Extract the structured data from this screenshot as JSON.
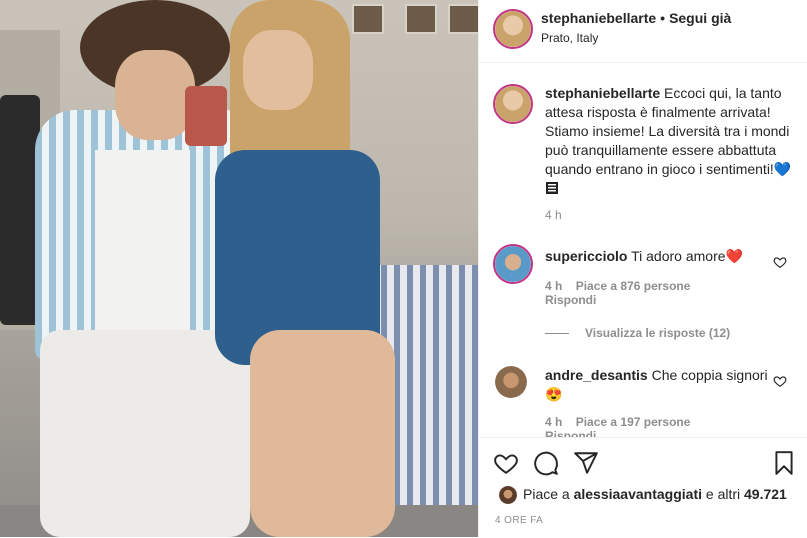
{
  "post": {
    "author": "stephaniebellarte",
    "follow_label": "Segui già",
    "dot": "•",
    "location": "Prato, Italy",
    "caption_user": "stephaniebellarte",
    "caption_text": "Eccoci qui, la tanto attesa risposta è finalmente arrivata! Stiamo insieme! La diversità tra i mondi può tranquillamente essere abbattuta quando entrano in gioco i sentimenti!💙",
    "caption_time": "4 h"
  },
  "comments": [
    {
      "user": "supericciolo",
      "text": "Ti adoro amore❤️",
      "time": "4 h",
      "likes": "Piace a 876 persone",
      "reply": "Rispondi",
      "view_replies": "Visualizza le risposte (12)"
    },
    {
      "user": "andre_desantis",
      "text": "Che coppia signori 😍",
      "time": "4 h",
      "likes": "Piace a 197 persone",
      "reply": "Rispondi"
    }
  ],
  "footer": {
    "likes_prefix": "Piace a",
    "likes_user": "alessiaavantaggiati",
    "likes_suffix": "e altri",
    "likes_count": "49.721",
    "time_ago": "4 ORE FA"
  },
  "icons": {
    "like": "heart-icon",
    "comment": "comment-icon",
    "share": "share-icon",
    "save": "bookmark-icon"
  },
  "colors": {
    "story_ring": "#c13584",
    "muted_text": "#8e8e8e",
    "heart_red": "#e0245e",
    "heart_blue": "#3b82f6"
  }
}
